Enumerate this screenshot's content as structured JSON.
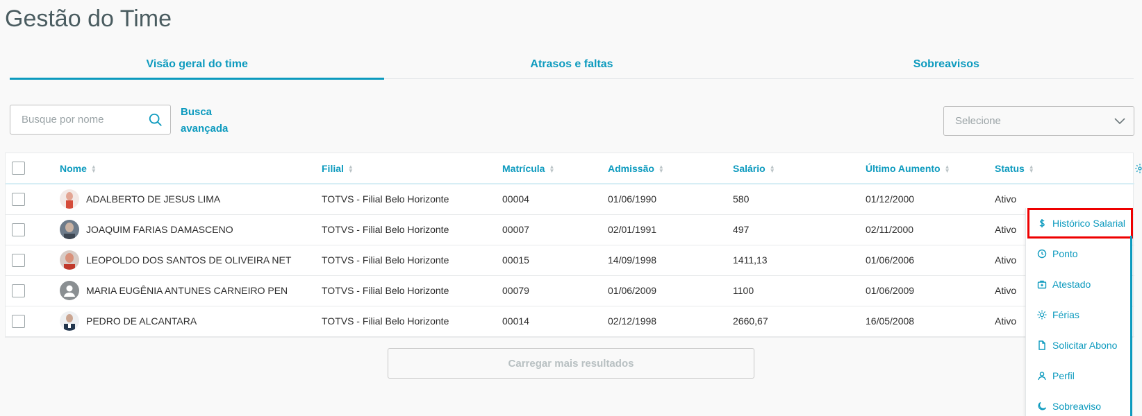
{
  "page": {
    "title": "Gestão do Time"
  },
  "tabs": [
    {
      "label": "Visão geral do time",
      "active": true
    },
    {
      "label": "Atrasos e faltas",
      "active": false
    },
    {
      "label": "Sobreavisos",
      "active": false
    }
  ],
  "search": {
    "placeholder": "Busque por nome",
    "value": "",
    "icon": "search-icon"
  },
  "advanced_search": {
    "label_line1": "Busca",
    "label_line2": "avançada"
  },
  "filter_select": {
    "placeholder": "Selecione",
    "icon": "chevron-down-icon"
  },
  "table": {
    "columns": [
      "Nome",
      "Filial",
      "Matrícula",
      "Admissão",
      "Salário",
      "Último Aumento",
      "Status"
    ],
    "rows": [
      {
        "nome": "ADALBERTO DE JESUS LIMA",
        "filial": "TOTVS - Filial Belo Horizonte",
        "matricula": "00004",
        "admissao": "01/06/1990",
        "salario": "580",
        "ultimo_aumento": "01/12/2000",
        "status": "Ativo"
      },
      {
        "nome": "JOAQUIM FARIAS DAMASCENO",
        "filial": "TOTVS - Filial Belo Horizonte",
        "matricula": "00007",
        "admissao": "02/01/1991",
        "salario": "497",
        "ultimo_aumento": "02/11/2000",
        "status": "Ativo"
      },
      {
        "nome": "LEOPOLDO DOS SANTOS DE OLIVEIRA NET",
        "filial": "TOTVS - Filial Belo Horizonte",
        "matricula": "00015",
        "admissao": "14/09/1998",
        "salario": "1411,13",
        "ultimo_aumento": "01/06/2006",
        "status": "Ativo"
      },
      {
        "nome": "MARIA EUGÊNIA ANTUNES CARNEIRO PEN",
        "filial": "TOTVS - Filial Belo Horizonte",
        "matricula": "00079",
        "admissao": "01/06/2009",
        "salario": "1100",
        "ultimo_aumento": "01/06/2009",
        "status": "Ativo"
      },
      {
        "nome": "PEDRO DE ALCANTARA",
        "filial": "TOTVS - Filial Belo Horizonte",
        "matricula": "00014",
        "admissao": "02/12/1998",
        "salario": "2660,67",
        "ultimo_aumento": "16/05/2008",
        "status": "Ativo"
      }
    ]
  },
  "load_more": {
    "label": "Carregar mais resultados"
  },
  "row_menu": {
    "items": [
      {
        "label": "Histórico Salarial",
        "icon": "dollar-icon"
      },
      {
        "label": "Ponto",
        "icon": "clock-icon"
      },
      {
        "label": "Atestado",
        "icon": "medical-kit-icon"
      },
      {
        "label": "Férias",
        "icon": "sun-icon"
      },
      {
        "label": "Solicitar Abono",
        "icon": "document-icon"
      },
      {
        "label": "Perfil",
        "icon": "user-icon"
      },
      {
        "label": "Sobreaviso",
        "icon": "moon-icon"
      }
    ]
  },
  "colors": {
    "accent": "#0c9abe",
    "highlight_border": "#ee0000"
  }
}
